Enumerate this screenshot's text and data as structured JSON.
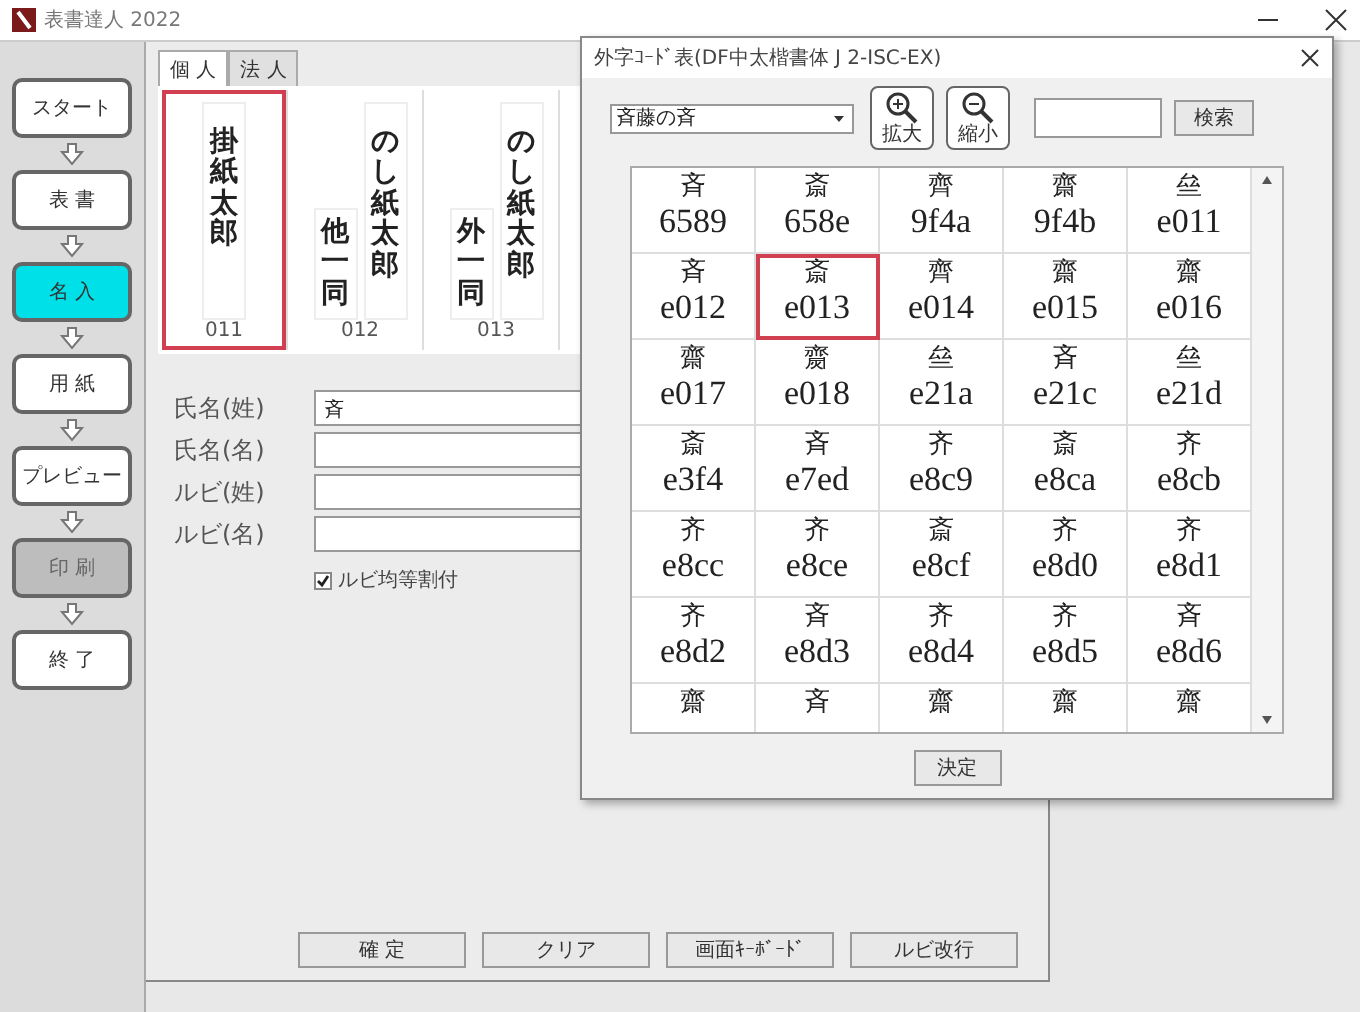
{
  "window": {
    "title": "表書達人 2022"
  },
  "steps": [
    {
      "label": "スタート",
      "selected": false,
      "disabled": false
    },
    {
      "label": "表 書",
      "selected": false,
      "disabled": false
    },
    {
      "label": "名 入",
      "selected": true,
      "disabled": false
    },
    {
      "label": "用 紙",
      "selected": false,
      "disabled": false
    },
    {
      "label": "プレビュー",
      "selected": false,
      "disabled": false
    },
    {
      "label": "印 刷",
      "selected": false,
      "disabled": true
    },
    {
      "label": "終 了",
      "selected": false,
      "disabled": false
    }
  ],
  "tabs": [
    {
      "label": "個 人",
      "selected": true
    },
    {
      "label": "法 人",
      "selected": false
    }
  ],
  "cards": [
    {
      "columns": [
        "掛紙太郎"
      ],
      "number": "011",
      "selected": true
    },
    {
      "columns": [
        "のし紙太郎",
        "他一同"
      ],
      "number": "012",
      "selected": false
    },
    {
      "columns": [
        "のし紙太郎",
        "外一同"
      ],
      "number": "013",
      "selected": false
    }
  ],
  "form": {
    "fields": [
      {
        "label": "氏名(姓)",
        "value": "斉"
      },
      {
        "label": "氏名(名)"
      },
      {
        "label": "ルビ(姓)"
      },
      {
        "label": "ルビ(名)"
      }
    ],
    "checkbox": {
      "label": "ルビ均等割付",
      "checked": true
    }
  },
  "buttons": [
    "確 定",
    "クリア",
    "画面ｷｰﾎﾞｰﾄﾞ",
    "ルビ改行"
  ],
  "dialog": {
    "title": "外字ｺｰﾄﾞ表(DF中太楷書体 J 2-ISC-EX)",
    "dropdown": "斉藤の斉",
    "zoom_in": "拡大",
    "zoom_out": "縮小",
    "search_button": "検索",
    "cells": [
      {
        "char": "斉",
        "code": "6589",
        "selected": false
      },
      {
        "char": "斎",
        "code": "658e",
        "selected": false
      },
      {
        "char": "齊",
        "code": "9f4a",
        "selected": false
      },
      {
        "char": "齋",
        "code": "9f4b",
        "selected": false
      },
      {
        "char": "亝",
        "code": "e011",
        "selected": false
      },
      {
        "char": "斉",
        "code": "e012",
        "selected": false
      },
      {
        "char": "斎",
        "code": "e013",
        "selected": true
      },
      {
        "char": "齊",
        "code": "e014",
        "selected": false
      },
      {
        "char": "齋",
        "code": "e015",
        "selected": false
      },
      {
        "char": "齋",
        "code": "e016",
        "selected": false
      },
      {
        "char": "齋",
        "code": "e017",
        "selected": false
      },
      {
        "char": "齌",
        "code": "e018",
        "selected": false
      },
      {
        "char": "亝",
        "code": "e21a",
        "selected": false
      },
      {
        "char": "斉",
        "code": "e21c",
        "selected": false
      },
      {
        "char": "亝",
        "code": "e21d",
        "selected": false
      },
      {
        "char": "斎",
        "code": "e3f4",
        "selected": false
      },
      {
        "char": "斉",
        "code": "e7ed",
        "selected": false
      },
      {
        "char": "齐",
        "code": "e8c9",
        "selected": false
      },
      {
        "char": "斎",
        "code": "e8ca",
        "selected": false
      },
      {
        "char": "齐",
        "code": "e8cb",
        "selected": false
      },
      {
        "char": "齐",
        "code": "e8cc",
        "selected": false
      },
      {
        "char": "齐",
        "code": "e8ce",
        "selected": false
      },
      {
        "char": "斎",
        "code": "e8cf",
        "selected": false
      },
      {
        "char": "齐",
        "code": "e8d0",
        "selected": false
      },
      {
        "char": "齐",
        "code": "e8d1",
        "selected": false
      },
      {
        "char": "齐",
        "code": "e8d2",
        "selected": false
      },
      {
        "char": "斉",
        "code": "e8d3",
        "selected": false
      },
      {
        "char": "齐",
        "code": "e8d4",
        "selected": false
      },
      {
        "char": "齐",
        "code": "e8d5",
        "selected": false
      },
      {
        "char": "斉",
        "code": "e8d6",
        "selected": false
      },
      {
        "char": "齋",
        "selected": false
      },
      {
        "char": "斉",
        "selected": false
      },
      {
        "char": "齋",
        "selected": false
      },
      {
        "char": "齋",
        "selected": false
      },
      {
        "char": "齋",
        "selected": false
      }
    ],
    "ok_button": "決定"
  }
}
